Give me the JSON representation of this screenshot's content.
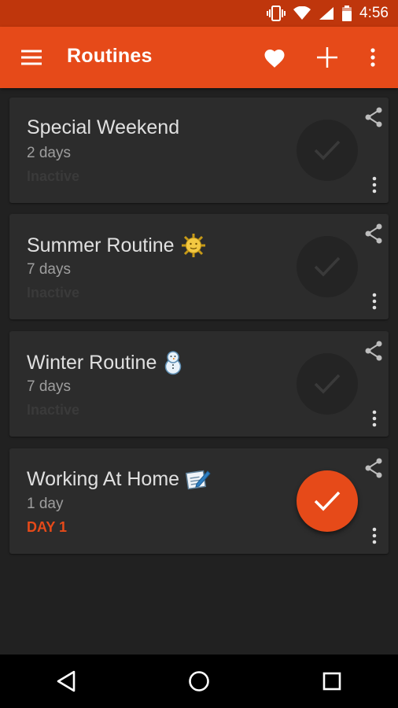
{
  "status": {
    "time": "4:56"
  },
  "toolbar": {
    "title": "Routines"
  },
  "colors": {
    "accent": "#e64a19",
    "status_bar": "#bf360c",
    "background": "#212121",
    "card": "#2c2c2c"
  },
  "routines": [
    {
      "name": "Special Weekend",
      "emoji": "",
      "duration": "2 days",
      "state": "Inactive",
      "active": false
    },
    {
      "name": "Summer Routine",
      "emoji": "sun-face-icon",
      "duration": "7 days",
      "state": "Inactive",
      "active": false
    },
    {
      "name": "Winter Routine",
      "emoji": "snowman-icon",
      "duration": "7 days",
      "state": "Inactive",
      "active": false
    },
    {
      "name": "Working At Home",
      "emoji": "memo-icon",
      "duration": "1 day",
      "state": "DAY 1",
      "active": true
    }
  ]
}
